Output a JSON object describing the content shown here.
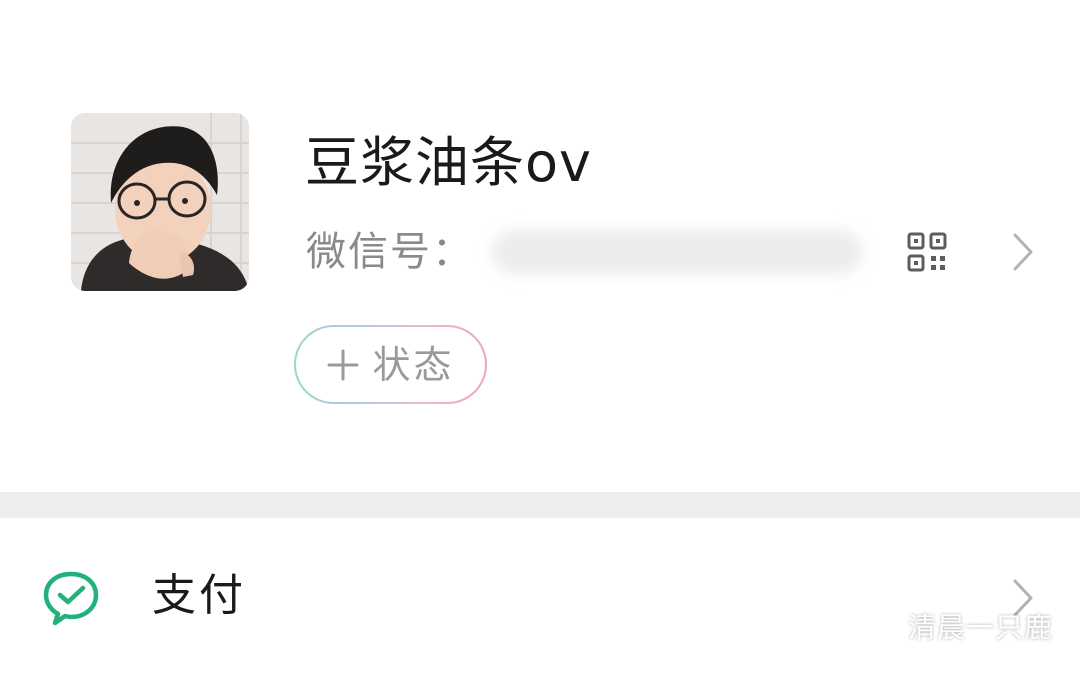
{
  "profile": {
    "nickname": "豆浆油条ov",
    "wechat_id_label": "微信号：",
    "wechat_id_value": "",
    "avatar_icon": "avatar-photo",
    "qr_icon": "qr-code-icon",
    "chevron_icon": "chevron-right-icon"
  },
  "status": {
    "plus": "+",
    "label": "状态",
    "border_gradient": [
      "#9bd7c4",
      "#b9c6ea",
      "#f1b6c5",
      "#e9a4c9"
    ]
  },
  "menu": {
    "items": [
      {
        "label": "支付",
        "icon": "wechat-pay-icon",
        "icon_color": "#20b27a",
        "chevron_icon": "chevron-right-icon"
      }
    ]
  },
  "watermark": {
    "text": "清晨一只鹿",
    "icon": "wechat-official-account-icon"
  },
  "colors": {
    "background": "#ffffff",
    "divider": "#ededed",
    "primary_text": "#1a1a1a",
    "secondary_text": "#8a8a8a"
  }
}
